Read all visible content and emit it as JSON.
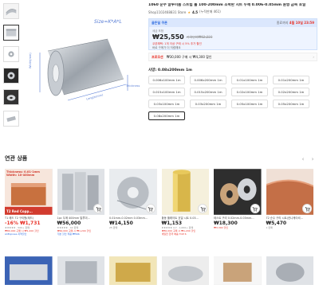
{
  "product": {
    "title": "1060 순수 알루미늄 스트립 롤 100-200mm 조박판 시트 두께 0.006-0.05mm 원형 금속 호일",
    "store": "Shop1102468831 Store",
    "rating": "4.5",
    "rating_suffix": "(누적판매 461)",
    "size_label": "Size=K*A*L",
    "dim_width": "Width(mm)",
    "dim_thick": "Thickness",
    "dim_length": "Length(mm)"
  },
  "price_box": {
    "deal_tag": "골든딜 쿠폰",
    "ends_label": "종료까지",
    "ends_time": "4월 10일 23:59",
    "tax_label": "세금 포함",
    "price": "₩25,550",
    "old_price": "가격인하₩62,223",
    "coupon_line": "쿠폰혜택: 1개 이상 구매 시 5% 추가 할인",
    "coupon_line2": "바로 구매가 더 저렴해요"
  },
  "promo": {
    "tag": "프로모션",
    "text": "₩30,000 구매 시 ₩4,300 할인"
  },
  "variants": {
    "heading": "사양: 0.08x200mm 1m",
    "items": [
      {
        "label": "0.006x100mm 1m"
      },
      {
        "label": "0.006x200mm 1m"
      },
      {
        "label": "0.01x100mm 1m"
      },
      {
        "label": "0.01x200mm 1m"
      },
      {
        "label": "0.015x100mm 1m"
      },
      {
        "label": "0.015x200mm 1m"
      },
      {
        "label": "0.02x100mm 1m"
      },
      {
        "label": "0.02x200mm 1m"
      },
      {
        "label": "0.03x100mm 1m"
      },
      {
        "label": "0.03x200mm 1m"
      },
      {
        "label": "0.05x100mm 1m"
      },
      {
        "label": "0.05x200mm 1m"
      },
      {
        "label": "0.08x200mm 1m"
      }
    ]
  },
  "related": {
    "title": "연관 상품",
    "cards": [
      {
        "name": "T1 레드 T2 구리원(레드)",
        "price": "-16% ₩1,731",
        "meta1": "★★★★★ · 500+ 판매",
        "meta2": "₩80,000 구매 시 ₩1,200 할인",
        "meta3": "AliExpress 지역할인",
        "img_text": "Thickness: 0.01-1mm  Width: 10-400mm",
        "img_bottom": "T2 Red Copp..."
      },
      {
        "name": "1pc 두께 400mm 알루미...",
        "price": "₩56,000",
        "meta1": "★★★★★ · 42 판매",
        "meta2": "₩60,000 구매 시 ₩1,200 할인",
        "meta3": "기본 할인 적용 ₩566",
        "img_text": "",
        "img_bottom": ""
      },
      {
        "name": "0.01mm-0.02mm 0.03mm...",
        "price": "₩14,150",
        "meta1": "25 판매",
        "meta2": "",
        "meta3": "",
        "img_text": "",
        "img_bottom": ""
      },
      {
        "name": "황동 플레이트 호일 시트 0.03...",
        "price": "₩1,153",
        "meta1": "★★★★★ 4.7 · 1,000+ 판매",
        "meta2": "₩80,000 구매 시 ₩1,200 할인",
        "meta3": "세일전 한국 배송 TOP 6",
        "img_text": "",
        "img_bottom": ""
      },
      {
        "name": "테스트 구리 0.02mm-0.03mm...",
        "price": "₩18,300",
        "meta1": "₩3,300 할인",
        "meta2": "",
        "meta3": "",
        "img_text": "",
        "img_bottom": ""
      },
      {
        "name": "T2 순수 구리 시트(컨니케이셔...",
        "price": "₩5,470",
        "meta1": "1 판매",
        "meta2": "",
        "meta3": "",
        "img_text": "",
        "img_bottom": ""
      }
    ]
  },
  "colors": {
    "accent_red": "#e8342a",
    "accent_blue": "#2d6be0",
    "price_box_bg": "#eef4ff"
  }
}
